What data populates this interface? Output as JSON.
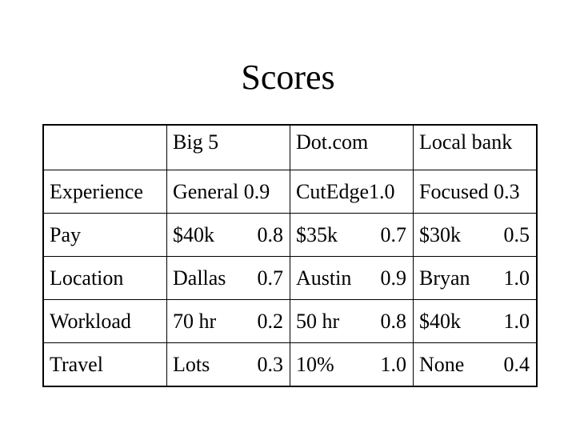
{
  "title": "Scores",
  "table": {
    "columns": [
      "",
      "Big 5",
      "Dot.com",
      "Local bank"
    ],
    "rows": [
      {
        "label": "Experience",
        "cells": [
          {
            "text": "General 0.9",
            "value": ""
          },
          {
            "text": "CutEdge1.0",
            "value": ""
          },
          {
            "text": "Focused 0.3",
            "value": ""
          }
        ]
      },
      {
        "label": "Pay",
        "cells": [
          {
            "text": "$40k",
            "value": "0.8"
          },
          {
            "text": "$35k",
            "value": "0.7"
          },
          {
            "text": "$30k",
            "value": "0.5"
          }
        ]
      },
      {
        "label": "Location",
        "cells": [
          {
            "text": "Dallas",
            "value": "0.7"
          },
          {
            "text": "Austin",
            "value": "0.9"
          },
          {
            "text": "Bryan",
            "value": "1.0"
          }
        ]
      },
      {
        "label": "Workload",
        "cells": [
          {
            "text": "70 hr",
            "value": "0.2"
          },
          {
            "text": "50 hr",
            "value": "0.8"
          },
          {
            "text": "$40k",
            "value": "1.0"
          }
        ]
      },
      {
        "label": "Travel",
        "cells": [
          {
            "text": "Lots",
            "value": "0.3"
          },
          {
            "text": "10%",
            "value": "1.0"
          },
          {
            "text": "None",
            "value": "0.4"
          }
        ]
      }
    ]
  }
}
